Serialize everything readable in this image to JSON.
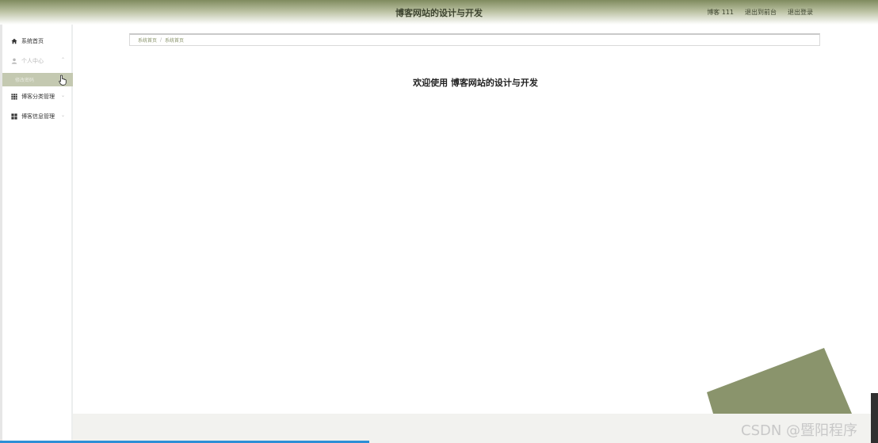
{
  "header": {
    "title": "博客网站的设计与开发",
    "user_label": "博客 111",
    "back_label": "退出到前台",
    "logout_label": "退出登录"
  },
  "sidebar": {
    "items": [
      {
        "label": "系统首页",
        "icon": "home-icon"
      },
      {
        "label": "个人中心",
        "icon": "user-icon"
      },
      {
        "label": "博客分类管理",
        "icon": "grid-icon"
      },
      {
        "label": "博客信息管理",
        "icon": "apps-icon"
      }
    ],
    "submenu_label": "修改密码"
  },
  "breadcrumb": {
    "root": "系统首页",
    "separator": "/",
    "current": "系统首页"
  },
  "main": {
    "welcome": "欢迎使用 博客网站的设计与开发"
  },
  "watermark": "CSDN @暨阳程序",
  "colors": {
    "accent": "#8a946c",
    "header_dark": "#7f8a5e",
    "submenu_bg": "#c4c9b1"
  }
}
